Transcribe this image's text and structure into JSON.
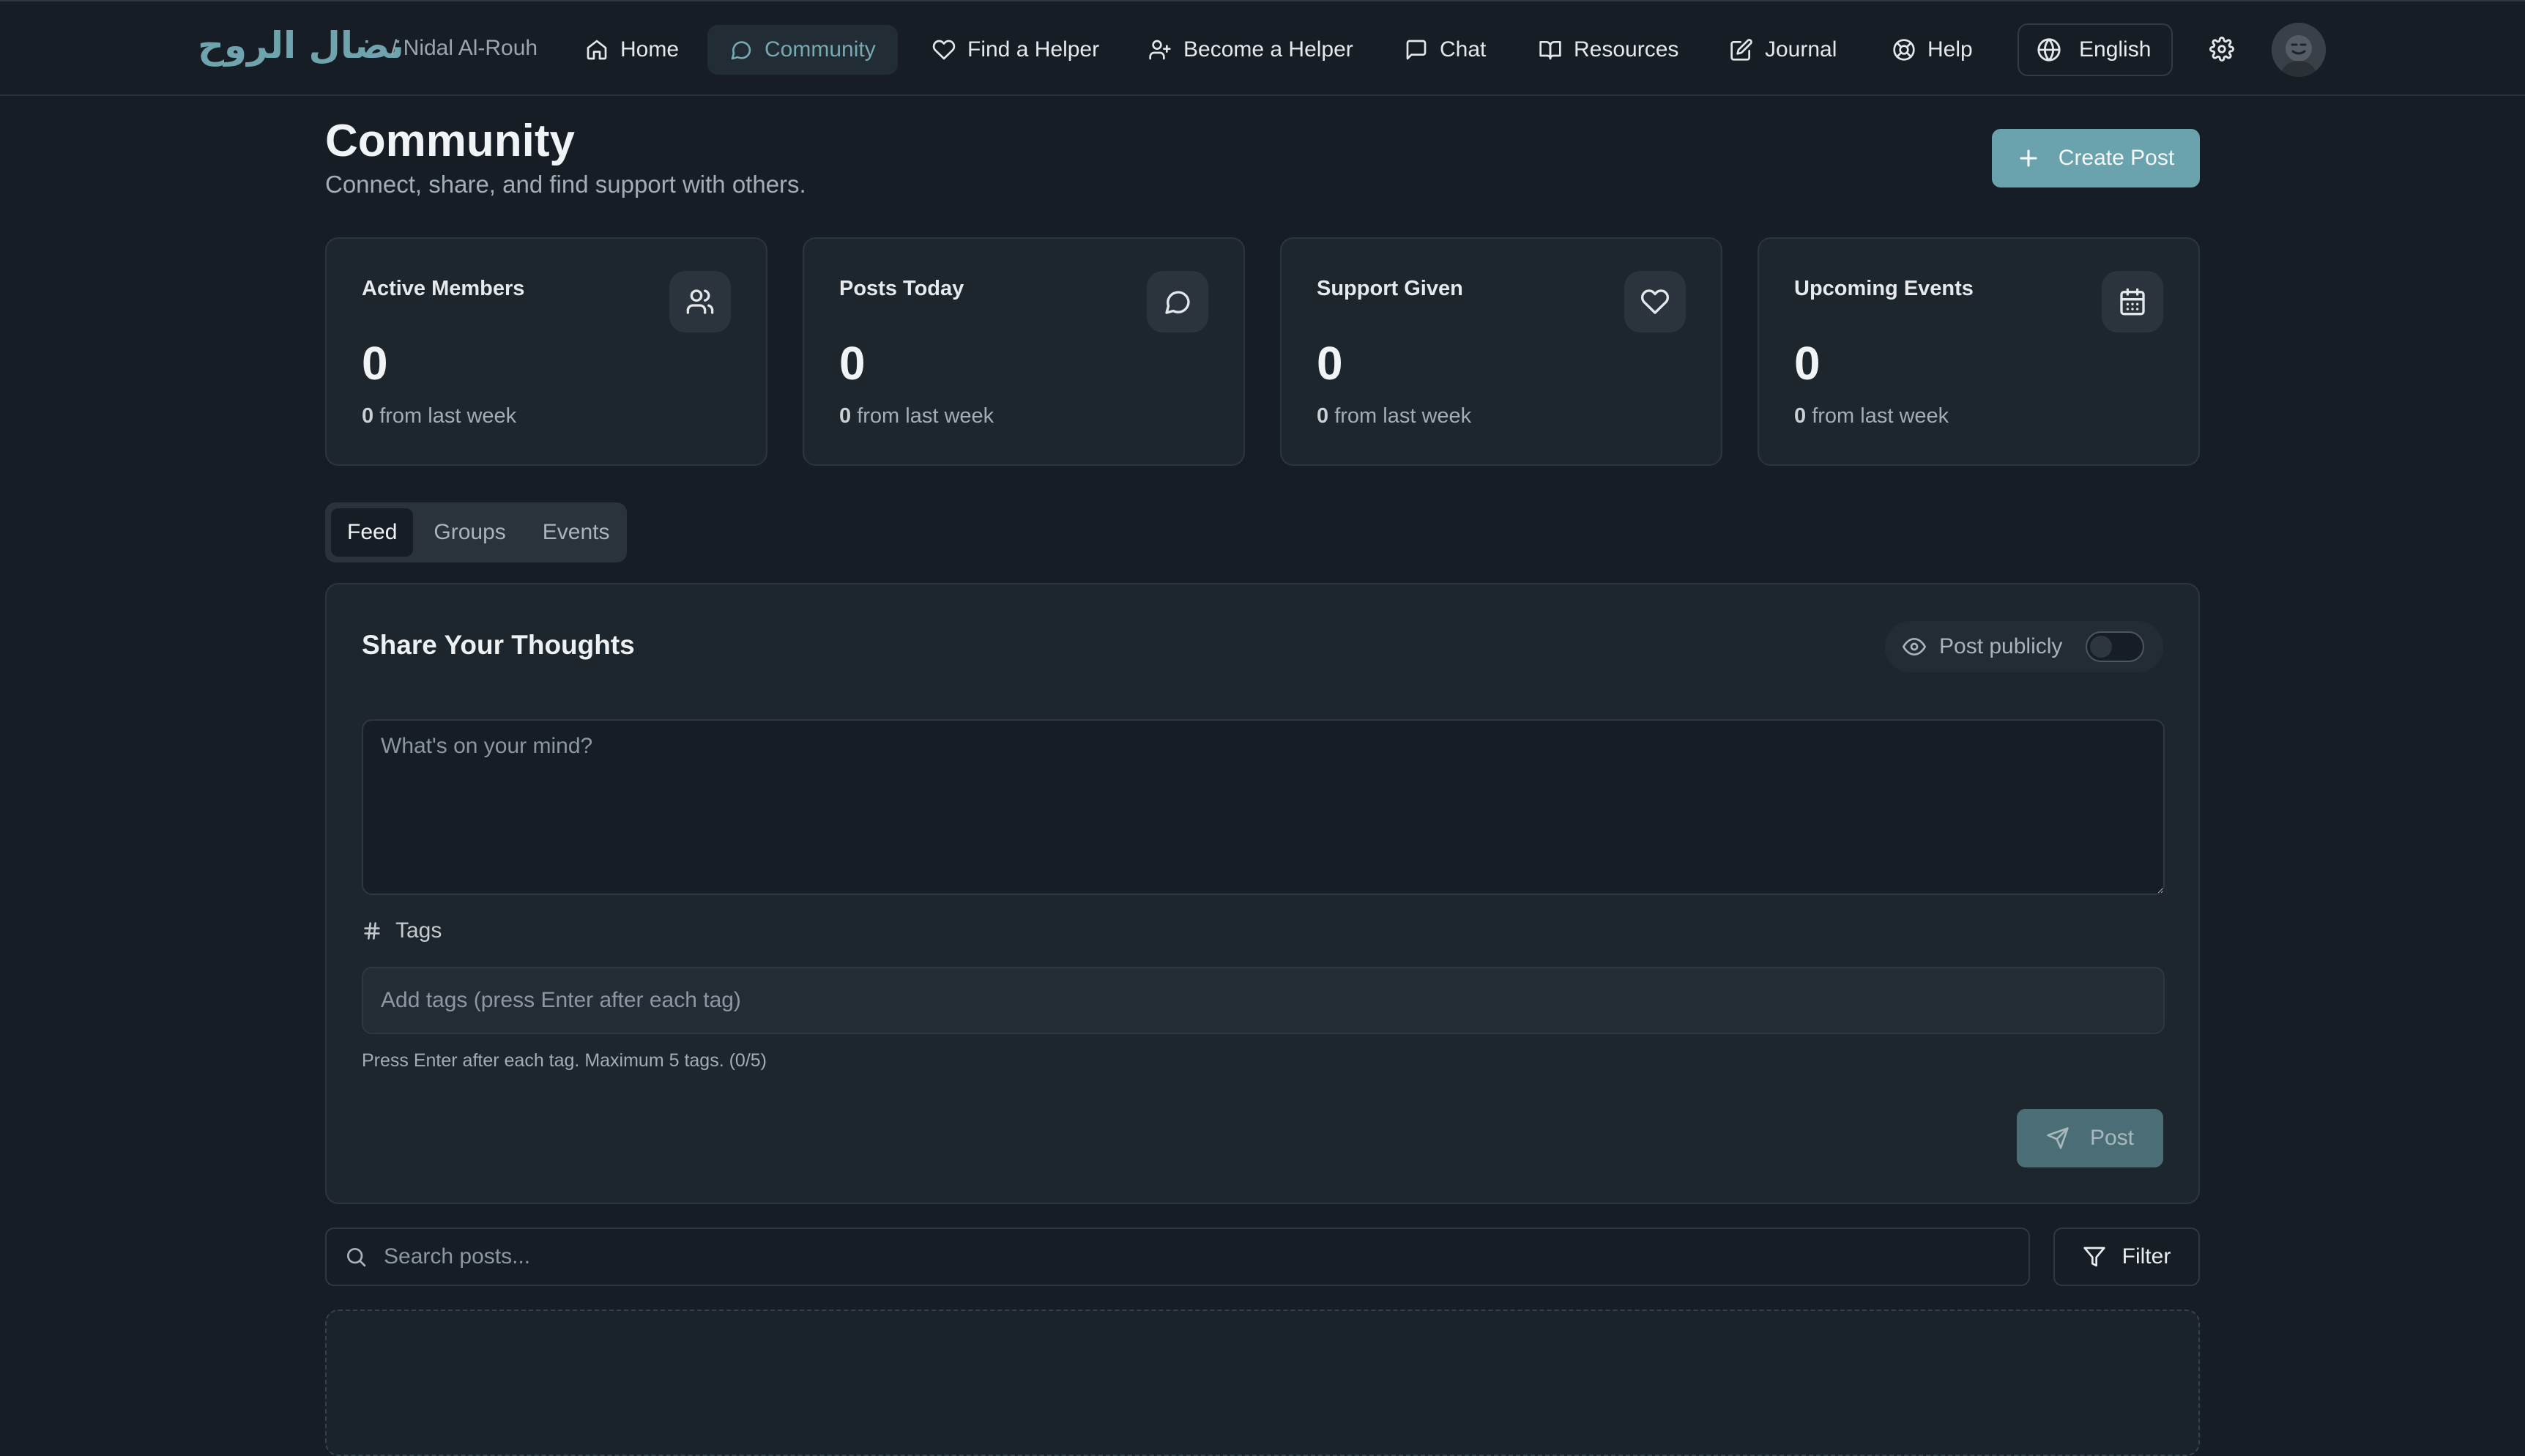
{
  "brand": {
    "name": "نضال الروح",
    "user": "/ Nidal Al-Rouh"
  },
  "nav": {
    "items": [
      {
        "label": "Home",
        "icon": "home-icon"
      },
      {
        "label": "Community",
        "icon": "message-circle-icon"
      },
      {
        "label": "Find a Helper",
        "icon": "heart-icon"
      },
      {
        "label": "Become a Helper",
        "icon": "user-plus-icon"
      },
      {
        "label": "Chat",
        "icon": "message-square-icon"
      },
      {
        "label": "Resources",
        "icon": "book-open-icon"
      },
      {
        "label": "Journal",
        "icon": "edit-icon"
      },
      {
        "label": "Help",
        "icon": "life-buoy-icon"
      }
    ],
    "active": "Community",
    "language": "English"
  },
  "header": {
    "title": "Community",
    "subtitle": "Connect, share, and find support with others.",
    "create_label": "Create Post"
  },
  "stats": [
    {
      "label": "Active Members",
      "value": "0",
      "change": "0",
      "change_suffix": "from last week",
      "icon": "users-icon"
    },
    {
      "label": "Posts Today",
      "value": "0",
      "change": "0",
      "change_suffix": "from last week",
      "icon": "message-circle-icon"
    },
    {
      "label": "Support Given",
      "value": "0",
      "change": "0",
      "change_suffix": "from last week",
      "icon": "heart-icon"
    },
    {
      "label": "Upcoming Events",
      "value": "0",
      "change": "0",
      "change_suffix": "from last week",
      "icon": "calendar-icon"
    }
  ],
  "tabs": [
    {
      "label": "Feed"
    },
    {
      "label": "Groups"
    },
    {
      "label": "Events"
    }
  ],
  "active_tab": "Feed",
  "composer": {
    "title": "Share Your Thoughts",
    "public_label": "Post publicly",
    "public_enabled": false,
    "placeholder": "What's on your mind?",
    "tags_label": "Tags",
    "tags_placeholder": "Add tags (press Enter after each tag)",
    "tags_hint": "Press Enter after each tag. Maximum 5 tags. (0/5)",
    "post_label": "Post"
  },
  "search": {
    "placeholder": "Search posts...",
    "filter_label": "Filter"
  },
  "colors": {
    "background": "#161d24",
    "card": "#1d252d",
    "accent": "#6aa2ad",
    "accent_muted": "#4b6e76",
    "border": "#2b353e"
  }
}
